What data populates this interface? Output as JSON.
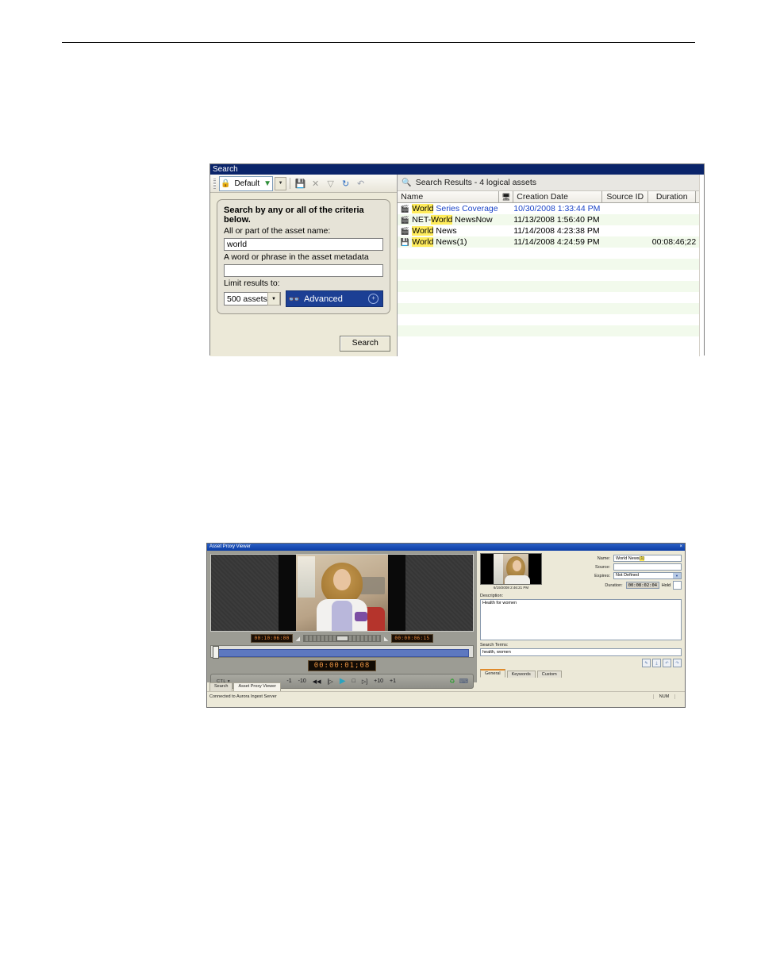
{
  "search_window": {
    "title": "Search",
    "toolbar": {
      "preset_label": "Default",
      "preset_icon": "lock-icon",
      "filter_icon": "funnel-green-icon",
      "dropdown_icon": "chevron-down-icon",
      "buttons": [
        {
          "name": "save-icon",
          "glyph": "💾"
        },
        {
          "name": "delete-icon",
          "glyph": "✕"
        },
        {
          "name": "clear-filter-icon",
          "glyph": "▽"
        },
        {
          "name": "refresh-icon",
          "glyph": "↻"
        },
        {
          "name": "undo-icon",
          "glyph": "↶"
        }
      ]
    },
    "criteria": {
      "heading": "Search by any or all of the criteria below.",
      "name_label": "All or part of the asset name:",
      "name_value": "world",
      "name_placeholder": "",
      "metadata_label": "A word or phrase in the asset metadata",
      "metadata_value": "",
      "metadata_placeholder": "",
      "limit_label": "Limit results to:",
      "limit_value": "500 assets",
      "advanced_label": "Advanced",
      "advanced_expand": "+"
    },
    "search_button": "Search"
  },
  "results": {
    "header_icon": "search-results-icon",
    "header_text": "Search Results - 4 logical assets",
    "columns": [
      "Name",
      "",
      "Creation Date",
      "Source ID",
      "Duration"
    ],
    "column_icon": "monitor-icon",
    "rows": [
      {
        "icon": "clip-icon",
        "name_highlight": "World",
        "name_rest": " Series Coverage",
        "creation_date": "10/30/2008 1:33:44 PM",
        "source_id": "",
        "duration": "",
        "selected": true
      },
      {
        "icon": "clip-icon",
        "name_prefix": "NET-",
        "name_highlight": "World",
        "name_rest": " NewsNow",
        "creation_date": "11/13/2008 1:56:40 PM",
        "source_id": "",
        "duration": "",
        "selected": false
      },
      {
        "icon": "clip-icon",
        "name_highlight": "World",
        "name_rest": " News",
        "creation_date": "11/14/2008 4:23:38 PM",
        "source_id": "",
        "duration": "",
        "selected": false
      },
      {
        "icon": "media-icon",
        "name_highlight": "World",
        "name_rest": " News(1)",
        "creation_date": "11/14/2008 4:24:59 PM",
        "source_id": "",
        "duration": "00:08:46;22",
        "selected": false
      }
    ],
    "empty_row_count": 8,
    "row_color_odd": "#ffffff",
    "row_color_even": "#f2faec",
    "highlight_color": "#ffec5c",
    "selected_text_color": "#1b44c8"
  },
  "viewer_window": {
    "title": "Asset Proxy Viewer",
    "close_glyph": "×",
    "player": {
      "mark_in": "00:10:06:00",
      "mark_out": "00:00:06:15",
      "current_timecode": "00:00:01;08",
      "ctl_label": "CTL",
      "ctl_dropdown": "▾",
      "transport_buttons": [
        {
          "name": "step-back-1-button",
          "label": "-1"
        },
        {
          "name": "step-back-10-button",
          "label": "-10"
        },
        {
          "name": "rewind-button",
          "label": "◀◀"
        },
        {
          "name": "mark-in-button",
          "label": "[▷"
        },
        {
          "name": "play-button",
          "label": "▶"
        },
        {
          "name": "stop-button",
          "label": "□"
        },
        {
          "name": "mark-out-button",
          "label": "▷]"
        },
        {
          "name": "step-forward-10-button",
          "label": "+10"
        },
        {
          "name": "step-forward-1-button",
          "label": "+1"
        }
      ],
      "right_icons": [
        {
          "name": "eject-icon",
          "glyph": "♻"
        },
        {
          "name": "monitor-icon",
          "glyph": "⌨"
        }
      ]
    },
    "metadata": {
      "thumbnail_date": "6/19/2008 2:46:21 PM",
      "name_label": "Name:",
      "name_value_prefix": "World News",
      "name_value_highlight": "(1)",
      "source_label": "Source:",
      "source_value": "",
      "expires_label": "Expires:",
      "expires_value": "Not Defined",
      "duration_label": "Duration:",
      "duration_value": "00:08:02:04",
      "hold_label": "Hold",
      "hold_checked": false,
      "description_label": "Description:",
      "description_value": "Health for women",
      "search_terms_label": "Search Terms:",
      "search_terms_value": "health, women",
      "tool_buttons": [
        {
          "name": "add-metadata-icon",
          "glyph": "✎"
        },
        {
          "name": "import-metadata-icon",
          "glyph": "⤓"
        },
        {
          "name": "undo-metadata-icon",
          "glyph": "↶"
        },
        {
          "name": "redo-metadata-icon",
          "glyph": "↷"
        }
      ],
      "tabs": [
        {
          "label": "General",
          "active": true
        },
        {
          "label": "Keywords",
          "active": false
        },
        {
          "label": "Custom",
          "active": false
        }
      ]
    },
    "bottom_tabs": [
      {
        "label": "Search",
        "active": false
      },
      {
        "label": "Asset Proxy Viewer",
        "active": true
      }
    ],
    "status_bar": {
      "message": "Connected to Aurora Ingest Server",
      "indicators": [
        "NUM",
        ""
      ]
    }
  }
}
